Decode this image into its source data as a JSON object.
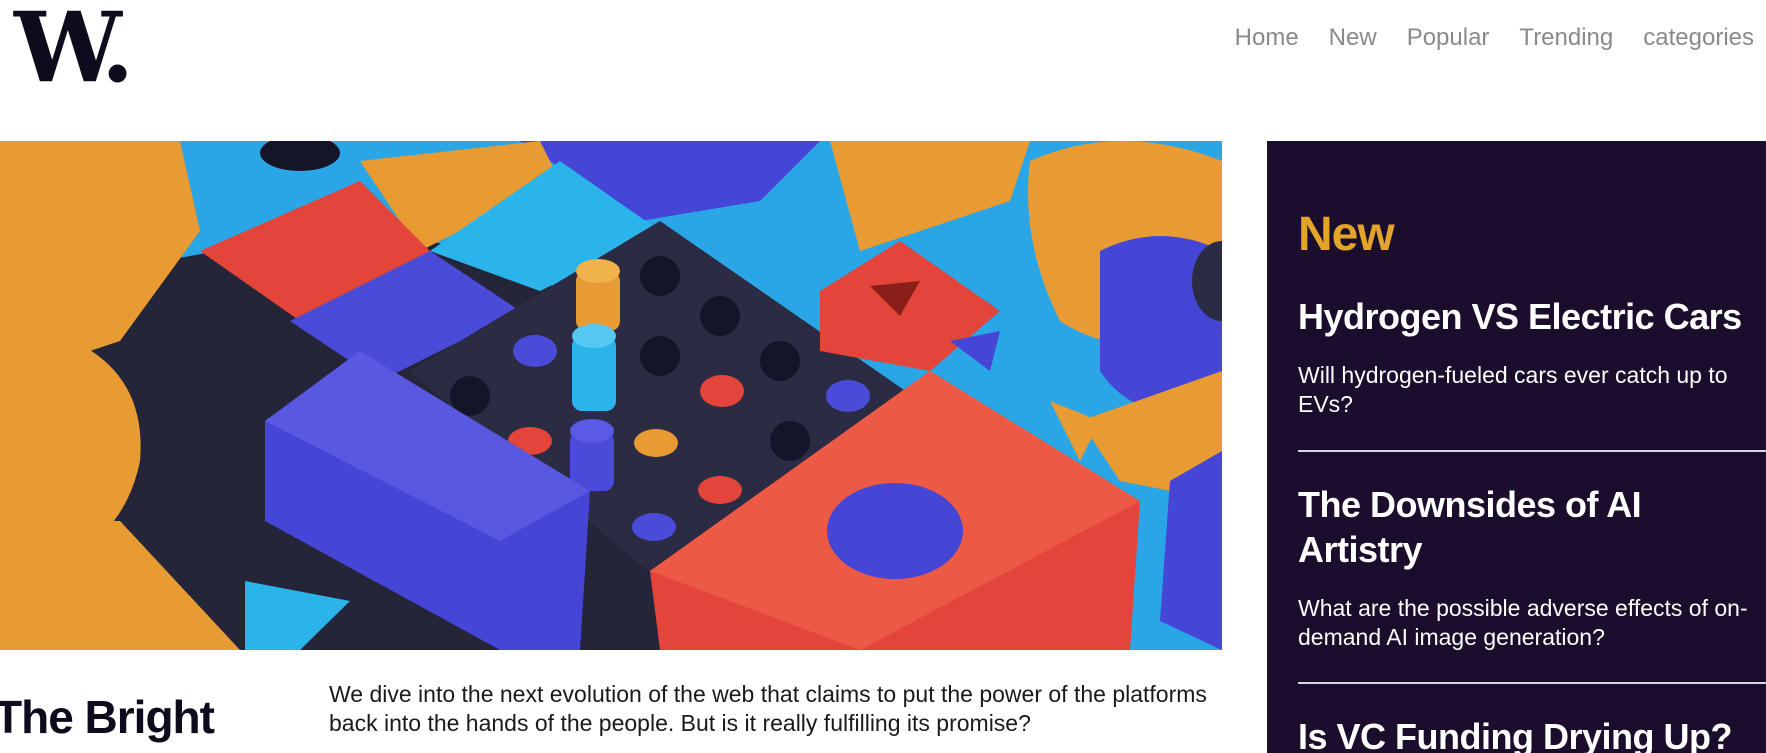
{
  "brand": {
    "logo_text": "W."
  },
  "nav": {
    "items": [
      "Home",
      "New",
      "Popular",
      "Trending",
      "categories"
    ]
  },
  "hero": {
    "image_subject": "colorful-3d-blocks-illustration"
  },
  "article": {
    "headline": "The Bright",
    "excerpt": "We dive into the next evolution of the web that claims to put the power of the platforms back into the hands of the people. But is it really fulfilling its promise?"
  },
  "sidebar": {
    "heading": "New",
    "items": [
      {
        "title": "Hydrogen VS Electric Cars",
        "desc": "Will hydrogen-fueled cars ever catch up to EVs?"
      },
      {
        "title": "The Downsides of AI Artistry",
        "desc": "What are the possible adverse effects of on-demand AI image generation?"
      },
      {
        "title": "Is VC Funding Drying Up?",
        "desc": ""
      }
    ]
  },
  "colors": {
    "sidebar_bg": "#1b0d2c",
    "accent": "#e3a42a",
    "nav_text": "#8a8a8a",
    "text_dark": "#0c0c1c"
  }
}
